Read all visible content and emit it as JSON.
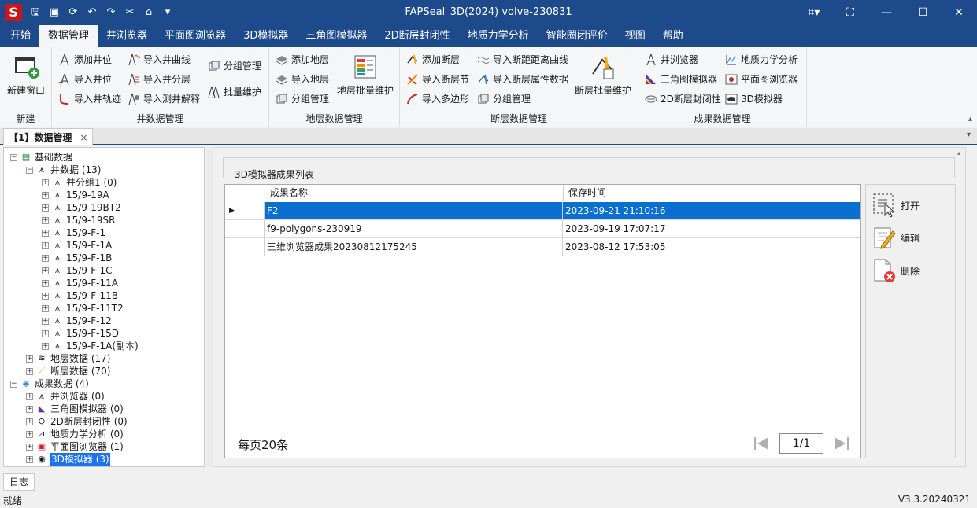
{
  "window": {
    "title": "FAPSeal_3D(2024) volve-230831",
    "logo": "S"
  },
  "menu": [
    "开始",
    "数据管理",
    "井浏览器",
    "平面图浏览器",
    "3D模拟器",
    "三角图模拟器",
    "2D断层封闭性",
    "地质力学分析",
    "智能圈闭评价",
    "视图",
    "帮助"
  ],
  "ribbon": {
    "new_group": {
      "label": "新建",
      "new_window": "新建窗口"
    },
    "well_group": {
      "label": "井数据管理",
      "add_well": "添加井位",
      "import_well": "导入井位",
      "import_track": "导入井轨迹",
      "import_curve": "导入井曲线",
      "import_layer": "导入井分层",
      "import_log": "导入测井解释",
      "group_manage": "分组管理",
      "batch": "批量维护"
    },
    "layer_group": {
      "label": "地层数据管理",
      "add_layer": "添加地层",
      "import_layer": "导入地层",
      "group_manage": "分组管理",
      "batch": "地层批量维护"
    },
    "fault_group": {
      "label": "断层数据管理",
      "add_fault": "添加断层",
      "import_node": "导入断层节",
      "import_polygon": "导入多边形",
      "import_curve": "导入断距距离曲线",
      "import_attr": "导入断层属性数据",
      "group_manage": "分组管理",
      "batch": "断层批量维护"
    },
    "result_group": {
      "label": "成果数据管理",
      "well_browser": "井浏览器",
      "tri": "三角图模拟器",
      "fault2d": "2D断层封闭性",
      "geo": "地质力学分析",
      "plan": "平面图浏览器",
      "sim3d": "3D模拟器"
    }
  },
  "doc_tab": {
    "label": "【1】数据管理",
    "close": "×"
  },
  "tree": {
    "base": "基础数据",
    "well_data": "井数据 (13)",
    "wells": [
      "井分组1 (0)",
      "15/9-19A",
      "15/9-19BT2",
      "15/9-19SR",
      "15/9-F-1",
      "15/9-F-1A",
      "15/9-F-1B",
      "15/9-F-1C",
      "15/9-F-11A",
      "15/9-F-11B",
      "15/9-F-11T2",
      "15/9-F-12",
      "15/9-F-15D",
      "15/9-F-1A(副本)"
    ],
    "layer_data": "地层数据 (17)",
    "fault_data": "断层数据 (70)",
    "results": "成果数据 (4)",
    "result_items": [
      "井浏览器 (0)",
      "三角图模拟器 (0)",
      "2D断层封闭性 (0)",
      "地质力学分析 (0)",
      "平面图浏览器 (1)",
      "3D模拟器 (3)"
    ]
  },
  "panel": {
    "title": "3D模拟器成果列表"
  },
  "grid": {
    "columns": [
      "成果名称",
      "保存时间"
    ],
    "rows": [
      {
        "name": "F2",
        "time": "2023-09-21 21:10:16"
      },
      {
        "name": "f9-polygons-230919",
        "time": "2023-09-19 17:07:17"
      },
      {
        "name": "三维浏览器成果20230812175245",
        "time": "2023-08-12 17:53:05"
      }
    ]
  },
  "pager": {
    "per_page": "每页20条",
    "page": "1/1"
  },
  "actions": {
    "open": "打开",
    "edit": "编辑",
    "delete": "删除"
  },
  "bottom_tab": "日志",
  "status": {
    "left": "就绪",
    "version": "V3.3.20240321"
  },
  "colors": {
    "titlebar": "#1d4a8a",
    "selection": "#0b6fd0"
  }
}
